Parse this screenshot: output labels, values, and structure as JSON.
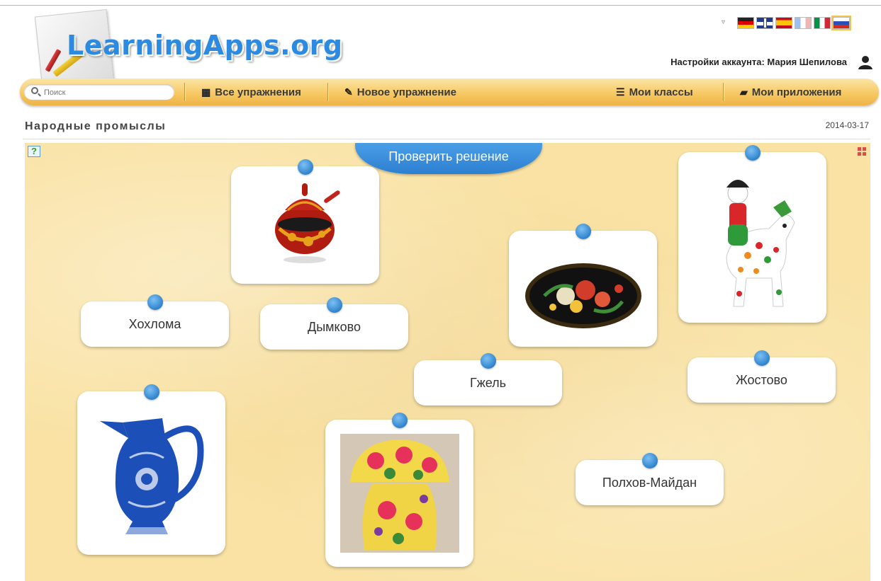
{
  "logo": {
    "text": "LearningApps.org"
  },
  "language": {
    "toggle": "▿",
    "flags": [
      "de",
      "gb",
      "es",
      "fr",
      "it",
      "ru"
    ]
  },
  "account": {
    "label": "Настройки аккаунта: Мария Шепилова",
    "icon": "user-icon"
  },
  "nav": {
    "search_placeholder": "Поиск",
    "all_exercises": "Все упражнения",
    "new_exercise": "Новое упражнение",
    "my_classes": "Мои классы",
    "my_apps": "Мои приложения"
  },
  "page": {
    "title": "Народные промыслы",
    "date": "2014-03-17"
  },
  "app": {
    "check_button": "Проверить решение",
    "help_icon": "?",
    "text_cards": [
      "Хохлома",
      "Дымково",
      "Гжель",
      "Жостово",
      "Полхов-Майдан"
    ],
    "image_cards": [
      "khokhloma-sugar-bowl-image",
      "zhostovo-tray-image",
      "dymkovo-toy-image",
      "gzhel-jug-image",
      "polkhov-maidan-mushroom-image"
    ]
  },
  "colors": {
    "accent": "#2f83cc",
    "navbar": "#f6c65f",
    "board": "#f9e2a4"
  }
}
